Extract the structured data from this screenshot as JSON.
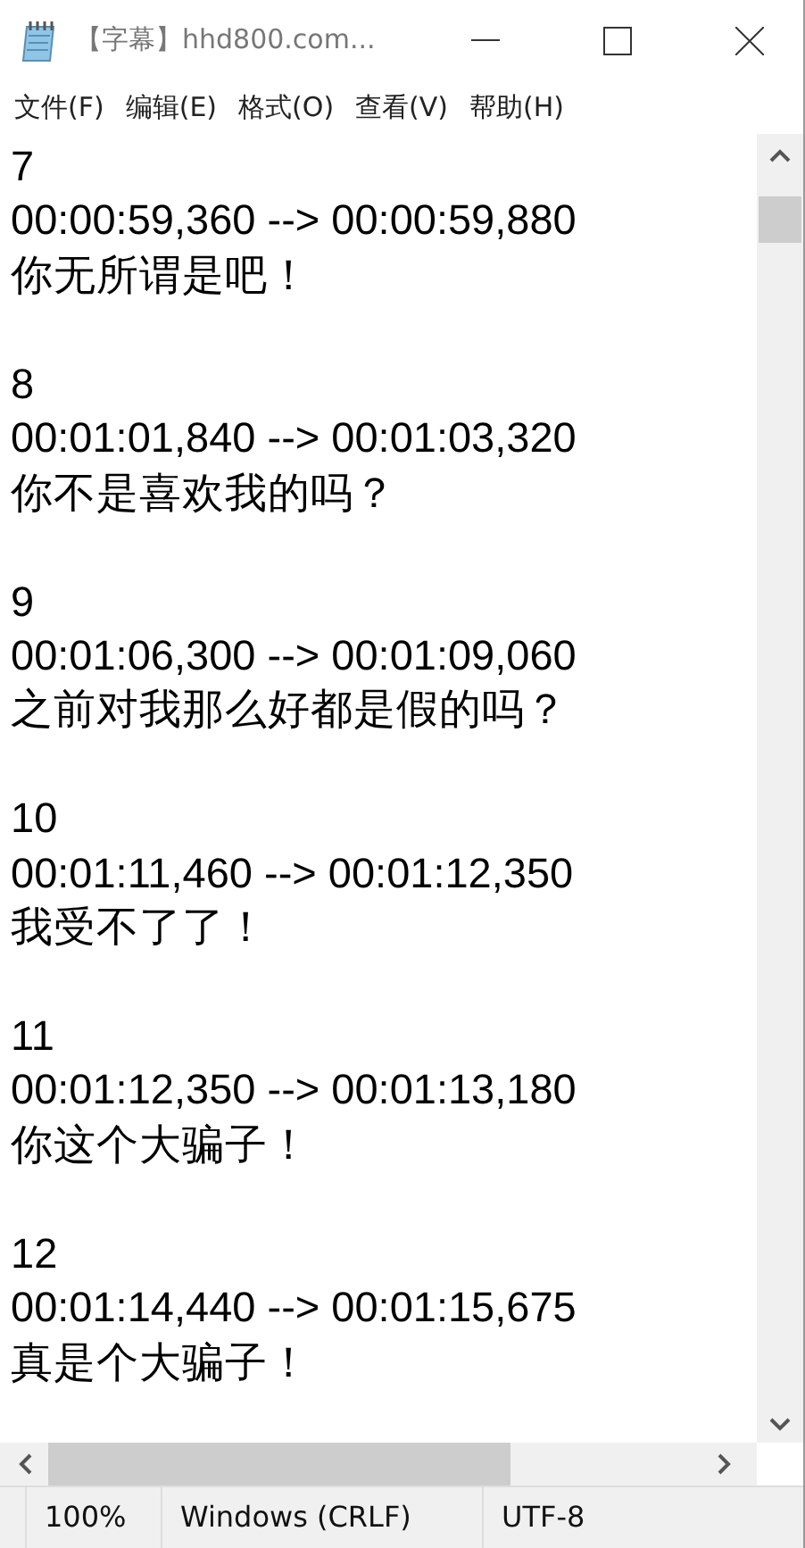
{
  "window": {
    "title": "【字幕】hhd800.com..."
  },
  "menu": [
    "文件(F)",
    "编辑(E)",
    "格式(O)",
    "查看(V)",
    "帮助(H)"
  ],
  "subtitles": [
    {
      "index": "7",
      "timing": "00:00:59,360 --> 00:00:59,880",
      "text": "你无所谓是吧！"
    },
    {
      "index": "8",
      "timing": "00:01:01,840 --> 00:01:03,320",
      "text": "你不是喜欢我的吗？"
    },
    {
      "index": "9",
      "timing": "00:01:06,300 --> 00:01:09,060",
      "text": "之前对我那么好都是假的吗？"
    },
    {
      "index": "10",
      "timing": "00:01:11,460 --> 00:01:12,350",
      "text": "我受不了了！"
    },
    {
      "index": "11",
      "timing": "00:01:12,350 --> 00:01:13,180",
      "text": "你这个大骗子！"
    },
    {
      "index": "12",
      "timing": "00:01:14,440 --> 00:01:15,675",
      "text": "真是个大骗子！"
    }
  ],
  "status_bar": [
    "100%",
    "Windows (CRLF)",
    "UTF-8"
  ]
}
